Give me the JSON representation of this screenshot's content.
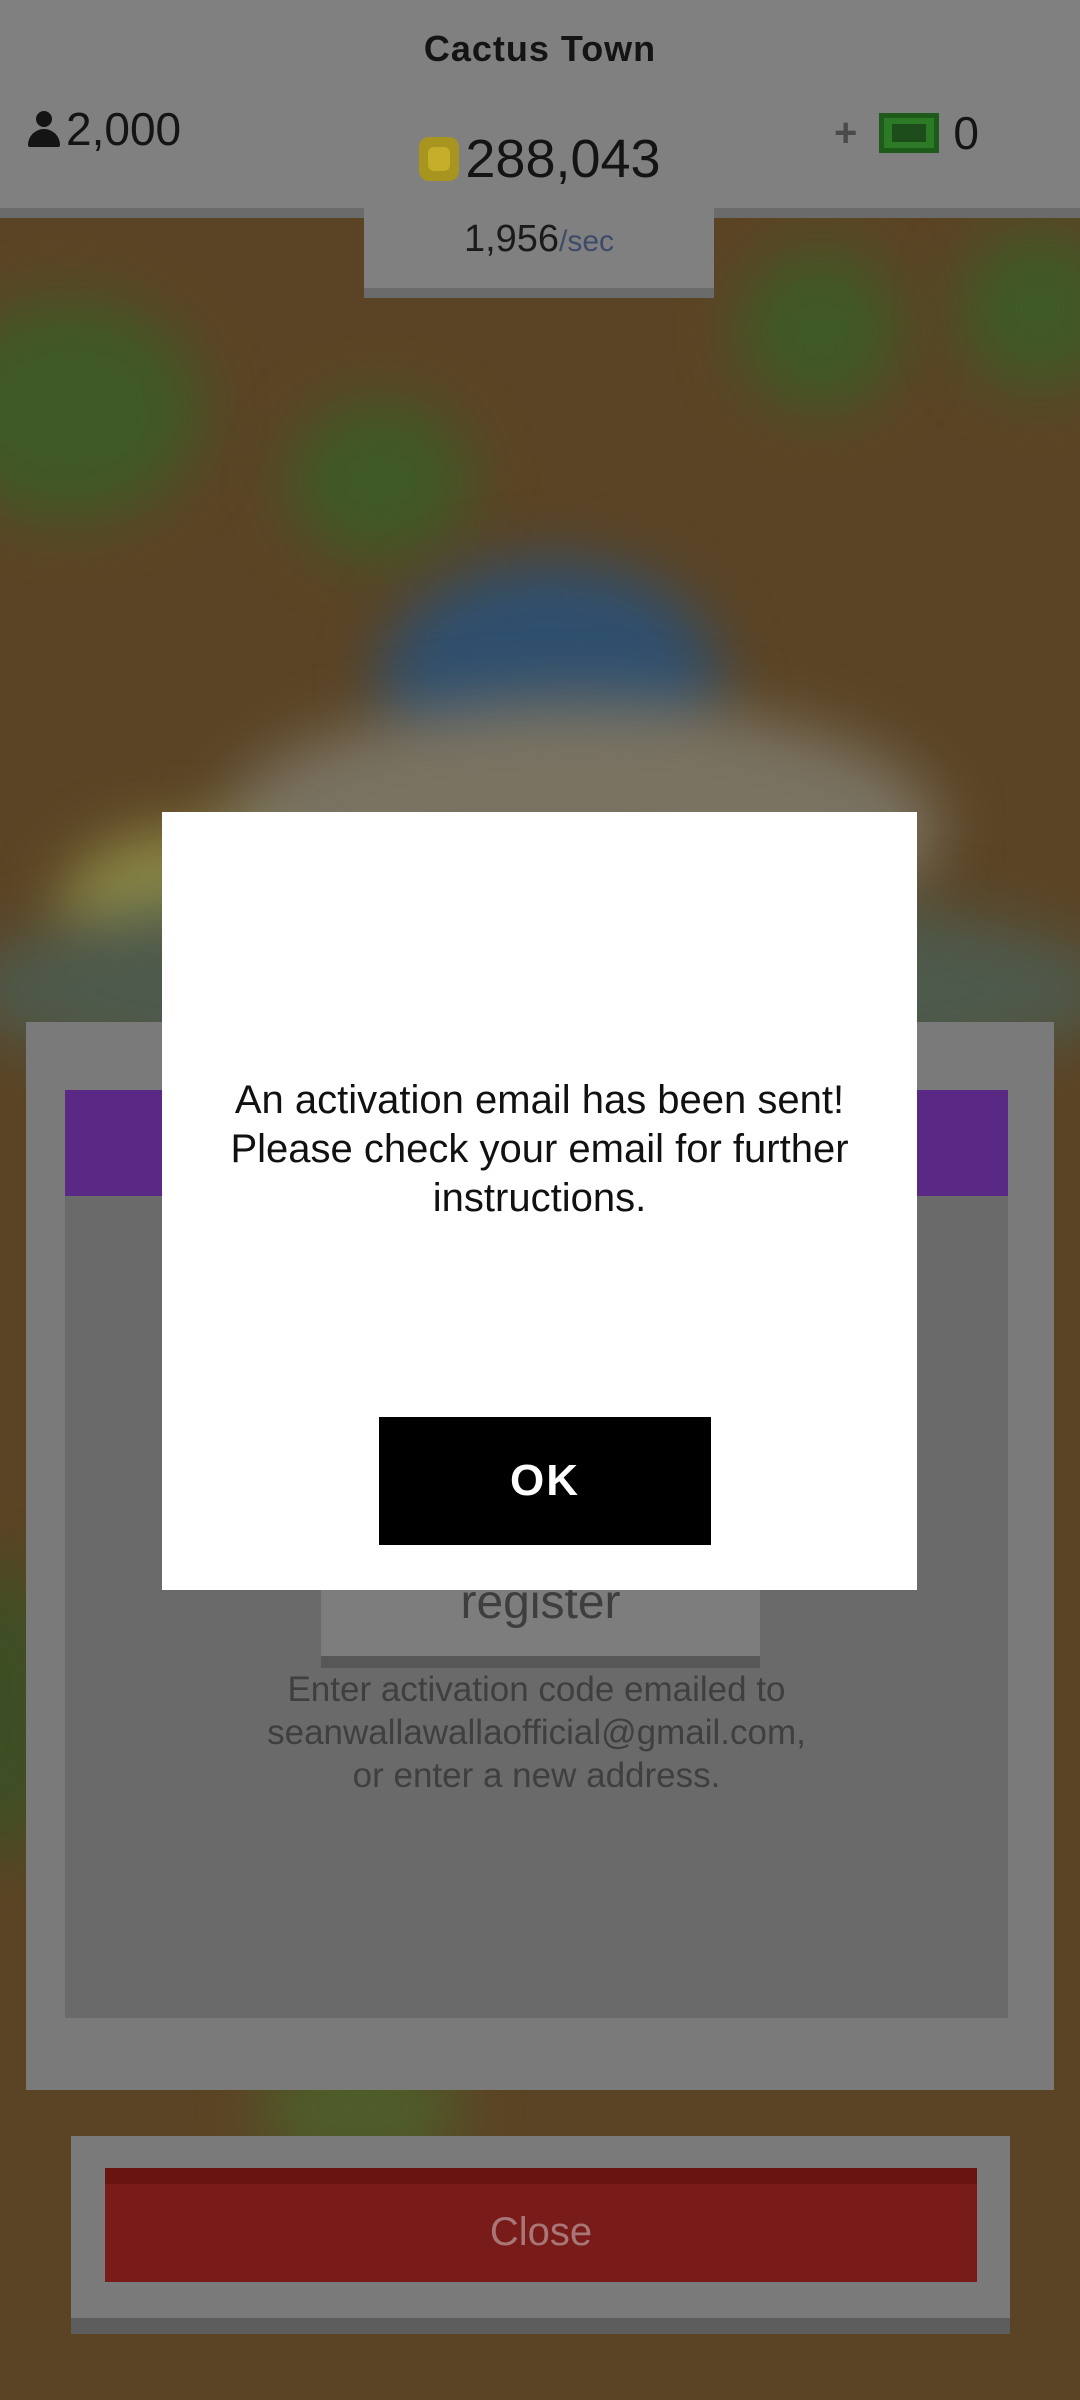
{
  "hud": {
    "town_name": "Cactus Town",
    "population": "2,000",
    "coins": "288,043",
    "rate_value": "1,956",
    "rate_unit": "/sec",
    "plus_label": "+",
    "cash": "0",
    "icons": [
      "person-icon",
      "coin-icon",
      "plus-icon",
      "cash-icon"
    ]
  },
  "register_panel": {
    "register_button_label": "register",
    "info_text": "Enter activation code emailed to\nseanwallawallaofficial@gmail.com,\nor enter a new address.",
    "close_label": "Close"
  },
  "dialog": {
    "message": "An activation email has been sent!\nPlease check your email for further\ninstructions.",
    "ok_label": "OK"
  },
  "colors": {
    "header_purple": "#5a2985",
    "close_red": "#791b18",
    "dialog_bg": "#ffffff",
    "ok_bg": "#000000",
    "ground": "#5b4425"
  }
}
